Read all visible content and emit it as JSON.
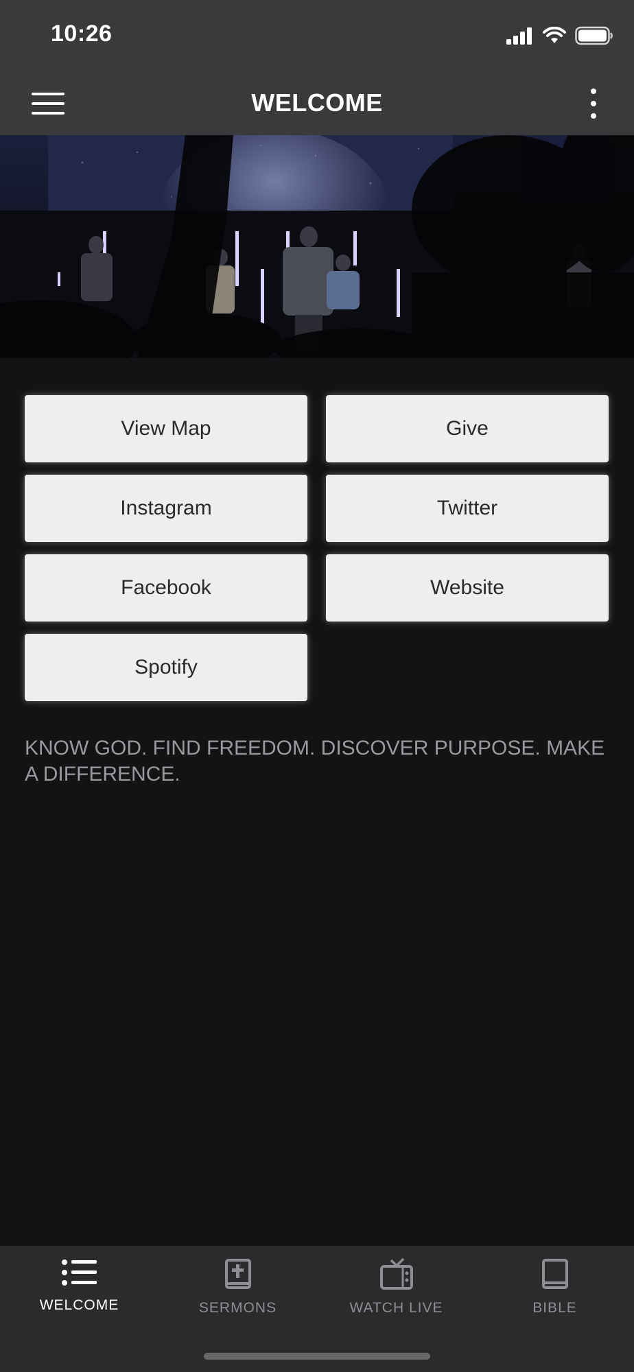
{
  "status": {
    "time": "10:26"
  },
  "header": {
    "title": "WELCOME"
  },
  "buttons": [
    "View Map",
    "Give",
    "Instagram",
    "Twitter",
    "Facebook",
    "Website",
    "Spotify"
  ],
  "tagline": "KNOW GOD. FIND FREEDOM. DISCOVER PURPOSE. MAKE A DIFFERENCE.",
  "tabs": [
    {
      "label": "WELCOME",
      "icon": "list-icon"
    },
    {
      "label": "SERMONS",
      "icon": "bible-cross-icon"
    },
    {
      "label": "WATCH LIVE",
      "icon": "tv-icon"
    },
    {
      "label": "BIBLE",
      "icon": "book-icon"
    }
  ],
  "colors": {
    "bar": "#3a3a3c",
    "background": "#131315",
    "button": "#eeeef0",
    "tab_active": "#ffffff",
    "tab_inactive": "#8e8e93"
  }
}
